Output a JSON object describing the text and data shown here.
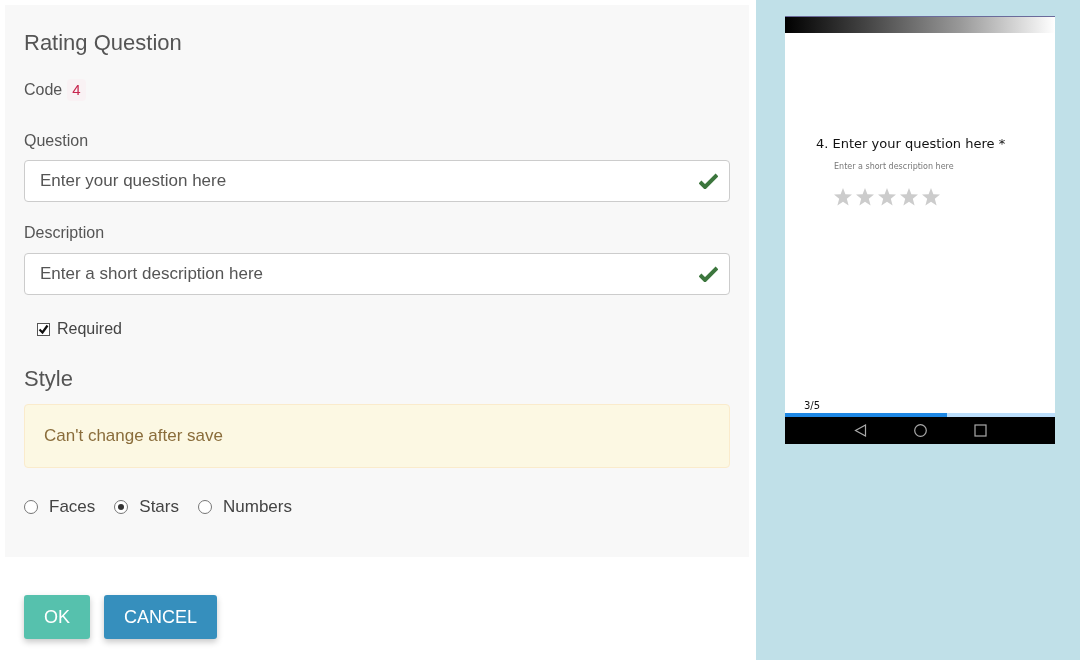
{
  "editor": {
    "title": "Rating Question",
    "code": {
      "label": "Code",
      "value": "4"
    },
    "fields": [
      {
        "label": "Question",
        "value": "Enter your question here",
        "valid": true
      },
      {
        "label": "Description",
        "value": "Enter a short description here",
        "valid": true
      }
    ],
    "required": {
      "label": "Required",
      "checked": true
    },
    "style": {
      "heading": "Style",
      "alert": "Can't change after save",
      "options": [
        {
          "label": "Faces",
          "selected": false
        },
        {
          "label": "Stars",
          "selected": true
        },
        {
          "label": "Numbers",
          "selected": false
        }
      ]
    }
  },
  "buttons": [
    {
      "label": "OK",
      "kind": "confirm"
    },
    {
      "label": "CANCEL",
      "kind": "cancel"
    }
  ],
  "preview": {
    "question": "4. Enter your question here *",
    "description": "Enter a short description here",
    "stars": 0,
    "page": "3/5",
    "progress": {
      "level": 0.6
    }
  }
}
